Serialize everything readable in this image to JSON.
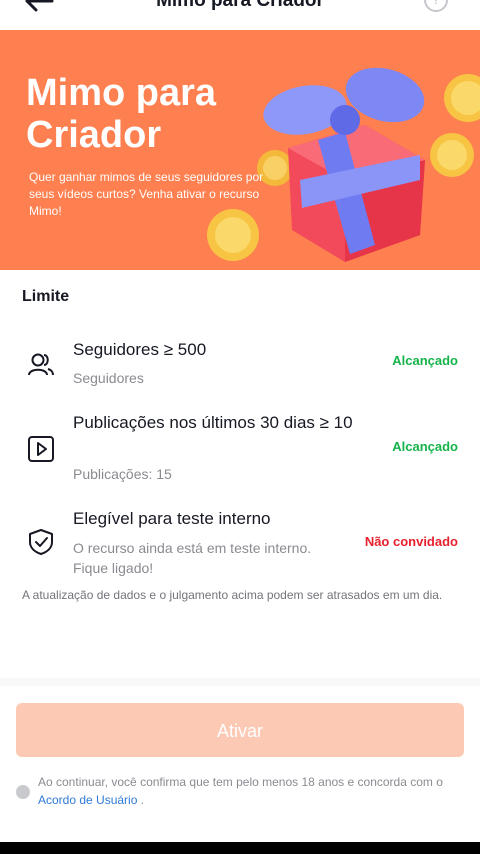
{
  "header": {
    "title": "Mimo para Criador",
    "back_icon": "arrow-left-icon",
    "help_icon": "question-circle-icon",
    "help_glyph": "?"
  },
  "banner": {
    "title": "Mimo para Criador",
    "subtitle": "Quer ganhar mimos de seus seguidores por seus vídeos curtos? Venha ativar o recurso Mimo!",
    "background_color": "#fe7f4f"
  },
  "requirements": {
    "title": "Limite",
    "items": [
      {
        "icon": "users-icon",
        "title": "Seguidores ≥ 500",
        "desc": "Seguidores",
        "status": "Alcançado"
      },
      {
        "icon": "play-box-icon",
        "title": "Publicações nos últimos 30 dias ≥ 10",
        "desc": "Publicações: 15",
        "status": "Alcançado"
      },
      {
        "icon": "shield-check-icon",
        "title": "Elegível para teste interno",
        "desc": "O recurso ainda está em teste interno. Fique ligado!",
        "status": "Não convidado"
      }
    ],
    "note": "A atualização de dados e o julgamento acima podem ser atrasados em um dia."
  },
  "actions": {
    "activate_label": "Ativar",
    "consent_text": "Ao continuar, você confirma que tem pelo menos 18 anos e concorda com o",
    "consent_link": "Acordo de Usuário",
    "consent_end": "."
  },
  "colors": {
    "accent": "#fe2c55",
    "success": "#16b34a",
    "error": "#e8202e",
    "button_disabled": "#fcc9b4"
  }
}
